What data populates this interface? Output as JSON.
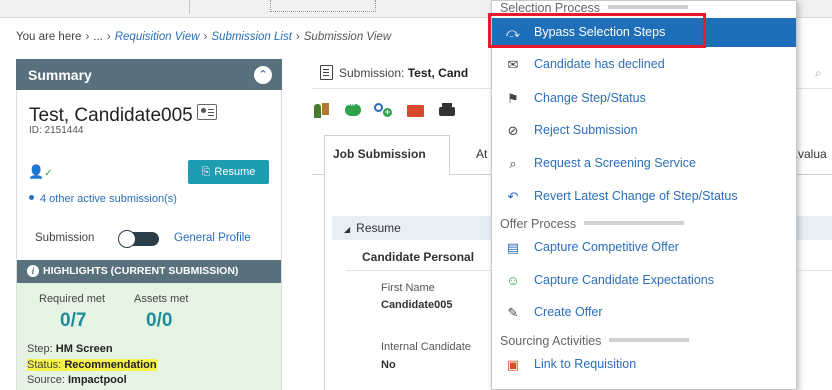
{
  "breadcrumb": {
    "prefix": "You are here",
    "ellipsis": "...",
    "link1": "Requisition View",
    "link2": "Submission List",
    "current": "Submission View"
  },
  "summary": {
    "title": "Summary",
    "candidate_name": "Test, Candidate005",
    "candidate_id": "ID: 2151444",
    "resume_button": "Resume",
    "other_submissions": "4 other active submission(s)",
    "toggle_left": "Submission",
    "toggle_right": "General Profile",
    "highlights_title": "HIGHLIGHTS (CURRENT SUBMISSION)",
    "required_met_label": "Required met",
    "assets_met_label": "Assets met",
    "required_met_value": "0/7",
    "assets_met_value": "0/0",
    "step_label": "Step:",
    "step_value": "HM Screen",
    "status_label": "Status:",
    "status_value": "Recommendation",
    "source_label": "Source:",
    "source_value": "Impactpool"
  },
  "main": {
    "submission_label": "Submission:",
    "submission_name": "Test, Cand",
    "tabs": [
      "Job Submission",
      "At",
      "Evalua"
    ],
    "resume_section": "Resume",
    "candidate_personal": "Candidate Personal",
    "first_name_label": "First Name",
    "first_name_value": "Candidate005",
    "internal_label": "Internal Candidate",
    "internal_value": "No"
  },
  "menu": {
    "groups": {
      "selection": "Selection Process",
      "offer": "Offer Process",
      "sourcing": "Sourcing Activities"
    },
    "items": [
      {
        "label": "Bypass Selection Steps",
        "icon": "bypass-arrows-icon",
        "selected": true
      },
      {
        "label": "Candidate has declined",
        "icon": "declined-icon"
      },
      {
        "label": "Change Step/Status",
        "icon": "change-step-icon"
      },
      {
        "label": "Reject Submission",
        "icon": "reject-icon"
      },
      {
        "label": "Request a Screening Service",
        "icon": "screening-icon"
      },
      {
        "label": "Revert Latest Change of Step/Status",
        "icon": "revert-icon"
      },
      {
        "label": "Capture Competitive Offer",
        "icon": "competitive-offer-icon"
      },
      {
        "label": "Capture Candidate Expectations",
        "icon": "expectations-icon"
      },
      {
        "label": "Create Offer",
        "icon": "create-offer-icon"
      },
      {
        "label": "Link to Requisition",
        "icon": "link-requisition-icon"
      }
    ]
  },
  "colors": {
    "header": "#59707d",
    "accent": "#1e6eb9",
    "link": "#2a6ebb",
    "button": "#1e9cb0",
    "highlight_bg": "#e6f4e4",
    "marker": "#f6f24a",
    "redbox": "#e8192c"
  }
}
